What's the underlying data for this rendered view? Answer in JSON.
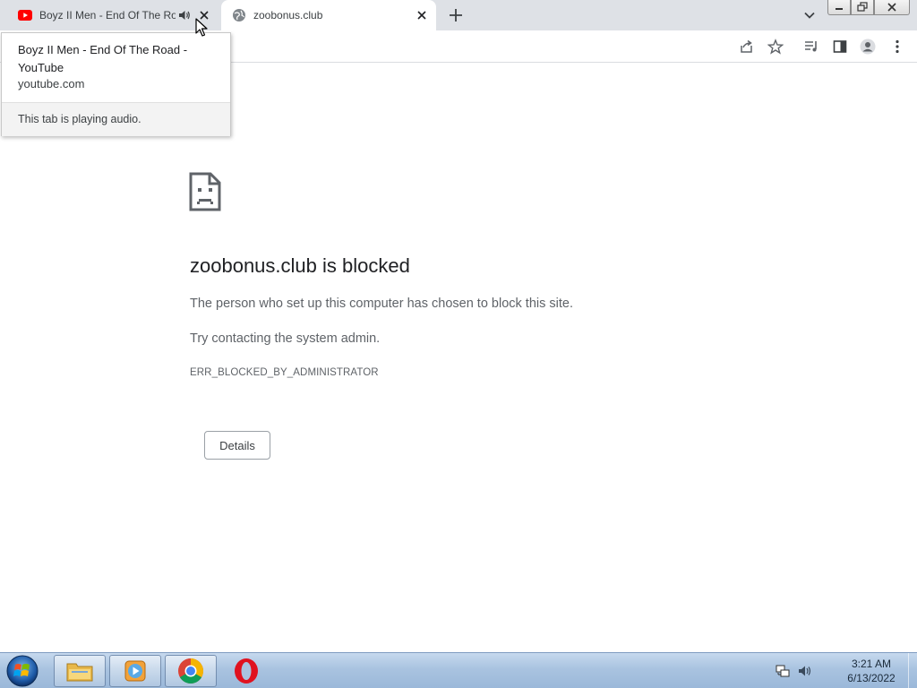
{
  "browser": {
    "tabs": [
      {
        "title": "Boyz II Men - End Of The Road - YouTube",
        "favicon": "youtube-icon",
        "audio": true
      },
      {
        "title": "zoobonus.club",
        "favicon": "globe-icon",
        "active": true
      }
    ],
    "tooltip": {
      "title": "Boyz II Men - End Of The Road - YouTube",
      "domain": "youtube.com",
      "audio_status": "This tab is playing audio."
    },
    "toolbar_icons": [
      "share-icon",
      "bookmark-star-icon",
      "media-control-icon",
      "side-panel-icon",
      "profile-icon",
      "menu-icon"
    ]
  },
  "page": {
    "heading": "zoobonus.club is blocked",
    "description": "The person who set up this computer has chosen to block this site.",
    "suggestion": "Try contacting the system admin.",
    "error_code": "ERR_BLOCKED_BY_ADMINISTRATOR",
    "details_label": "Details"
  },
  "taskbar": {
    "apps": [
      "windows-explorer",
      "windows-media-player",
      "google-chrome",
      "opera"
    ],
    "clock": {
      "time": "3:21 AM",
      "date": "6/13/2022"
    }
  },
  "colors": {
    "tabstrip": "#dee1e6",
    "youtube_red": "#ff0000",
    "text_primary": "#202124",
    "text_secondary": "#5f6368"
  }
}
